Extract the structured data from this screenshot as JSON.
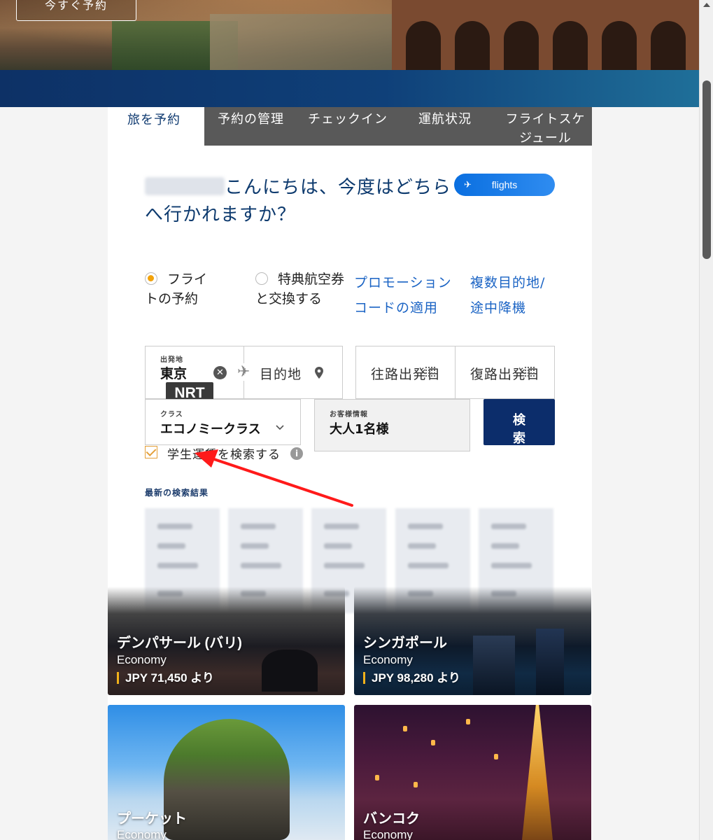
{
  "hero": {
    "button_label": "今すぐ予約"
  },
  "tabs": [
    {
      "label": "旅を予約"
    },
    {
      "label": "予約の管理"
    },
    {
      "label": "チェックイン"
    },
    {
      "label": "運航状況"
    },
    {
      "label": "フライトスケ",
      "label2": "ジュール"
    }
  ],
  "greeting": {
    "text": "こんにちは、今度はどちら",
    "text2": "へ行かれますか？"
  },
  "flights_badge": {
    "label": "flights"
  },
  "booking_options": {
    "flight": {
      "line1": "フライ",
      "line2": "トの予約"
    },
    "award": {
      "line1": "特典航空券",
      "line2": "と交換する"
    },
    "promo": {
      "line1": "プロモーション",
      "line2": "コードの適用"
    },
    "multi": {
      "line1": "複数目的地/",
      "line2": "途中降機"
    }
  },
  "search_form": {
    "origin": {
      "label": "出発地",
      "value": "東京",
      "code": "NRT"
    },
    "destination": {
      "placeholder": "目的地"
    },
    "depart_date": {
      "placeholder": "往路出発日"
    },
    "return_date": {
      "placeholder": "復路出発日"
    },
    "cabin": {
      "label": "クラス",
      "value": "エコノミークラス"
    },
    "passengers": {
      "label": "お客様情報",
      "value": "大人1名様"
    },
    "search_button": {
      "line1": "検",
      "line2": "索"
    },
    "student_fare": {
      "label": "学生運賃を検索する",
      "checked": true
    }
  },
  "recent": {
    "title": "最新の検索結果"
  },
  "destinations": [
    {
      "name": "デンパサール (バリ)",
      "class": "Economy",
      "price": "JPY 71,450 より"
    },
    {
      "name": "シンガポール",
      "class": "Economy",
      "price": "JPY 98,280 より"
    },
    {
      "name": "プーケット",
      "class": "Economy"
    },
    {
      "name": "バンコク",
      "class": "Economy"
    }
  ],
  "colors": {
    "accent_orange": "#f2a20a",
    "navy": "#0c2d6b",
    "link_blue": "#1a63c4",
    "annotation_red": "#ff1a1a"
  },
  "icons": [
    "clear-icon",
    "plane-icon",
    "location-pin-icon",
    "calendar-icon",
    "chevron-down-icon",
    "info-icon",
    "checkbox-check-icon"
  ]
}
